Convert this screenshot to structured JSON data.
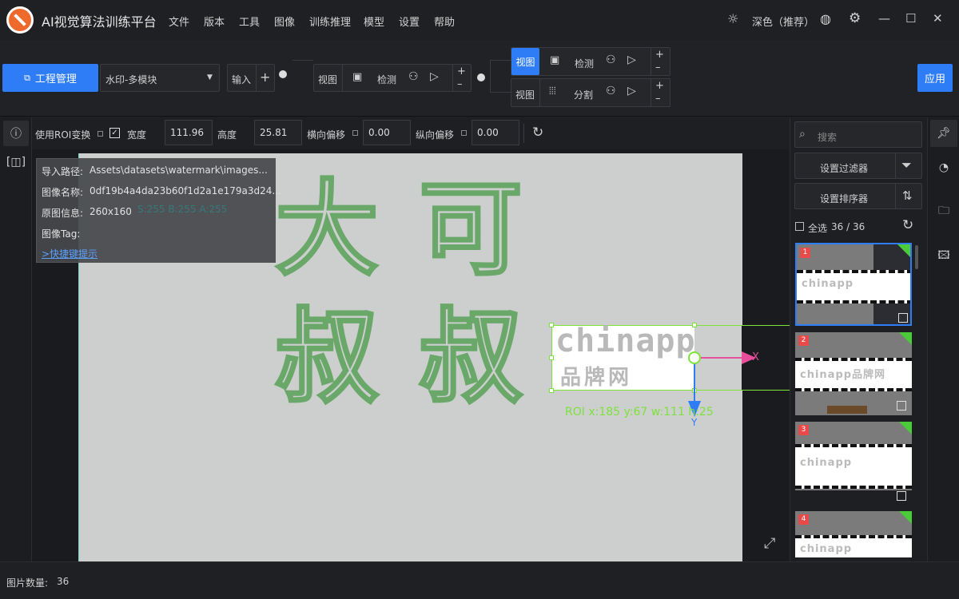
{
  "titlebar": {
    "app_title": "AI视觉算法训练平台",
    "menus": [
      "文件",
      "版本",
      "工具",
      "图像",
      "训练推理",
      "模型",
      "设置",
      "帮助"
    ],
    "theme_label": "深色（推荐）"
  },
  "toolbar": {
    "project_button": "工程管理",
    "project_select": "水印-多模块",
    "input_label": "输入",
    "row1": {
      "view": "视图",
      "module": "检测"
    },
    "row2_top": {
      "view": "视图",
      "module": "检测"
    },
    "row2_bottom": {
      "view": "视图",
      "module": "分割"
    },
    "apply_button": "应用"
  },
  "roi": {
    "use_roi_label": "使用ROI变换",
    "width_label": "宽度",
    "width_value": "111.96",
    "height_label": "高度",
    "height_value": "25.81",
    "hoffset_label": "横向偏移",
    "hoffset_value": "0.00",
    "voffset_label": "纵向偏移",
    "voffset_value": "0.00"
  },
  "info": {
    "path_label": "导入路径:",
    "path_value": "Assets\\datasets\\watermark\\images...",
    "name_label": "图像名称:",
    "name_value": "0df19b4a4da23b60f1d2a1e179a3d24...",
    "orig_label": "原图信息:",
    "orig_value": "260x160",
    "tag_label": "图像Tag:",
    "shortcut_link": ">快捷键提示",
    "pixel_ghost": "S:255 B:255 A:255"
  },
  "canvas": {
    "watermark_chars": [
      "大",
      "可",
      "叔",
      "叔"
    ],
    "roi_box_text1": "chinapp",
    "roi_box_text2": "品牌网",
    "roi_label": "ROI x:185 y:67 w:111 h:25",
    "axis_x": "X",
    "axis_y": "Y"
  },
  "right": {
    "search_placeholder": "搜索",
    "filter_button": "设置过滤器",
    "sorter_button": "设置排序器",
    "select_all": "全选",
    "count": "36 / 36",
    "thumbs": [
      {
        "index": "1",
        "text": "chinapp"
      },
      {
        "index": "2",
        "text": "chinapp品牌网"
      },
      {
        "index": "3",
        "text": "chinapp"
      },
      {
        "index": "4",
        "text": "chinapp"
      }
    ]
  },
  "status": {
    "label": "图片数量:",
    "value": "36"
  },
  "colors": {
    "accent": "#2e7cf6",
    "roi_green": "#7de23a",
    "axis_pink": "#e84e9a",
    "axis_blue": "#2e7cf6"
  }
}
